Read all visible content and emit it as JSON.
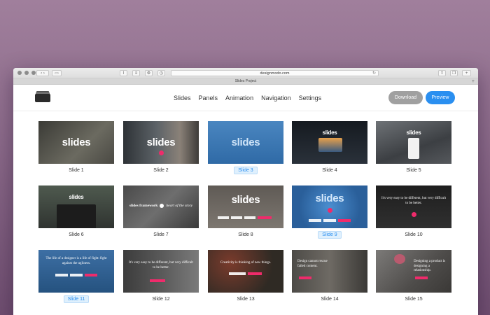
{
  "browser": {
    "url": "designmodo.com",
    "tab_title": "Slides Project",
    "tab_plus": "+"
  },
  "app": {
    "menu": [
      "Slides",
      "Panels",
      "Animation",
      "Navigation",
      "Settings"
    ],
    "download_label": "Download",
    "preview_label": "Preview"
  },
  "thumb_word": "slides",
  "slides": [
    {
      "label": "Slide 1",
      "active": false
    },
    {
      "label": "Slide 2",
      "active": false
    },
    {
      "label": "Slide 3",
      "active": true
    },
    {
      "label": "Slide 4",
      "active": false
    },
    {
      "label": "Slide 5",
      "active": false
    },
    {
      "label": "Slide 6",
      "active": false
    },
    {
      "label": "Slide 7",
      "active": false
    },
    {
      "label": "Slide 8",
      "active": false
    },
    {
      "label": "Slide 9",
      "active": true
    },
    {
      "label": "Slide 10",
      "active": false
    },
    {
      "label": "Slide 11",
      "active": true
    },
    {
      "label": "Slide 12",
      "active": false
    },
    {
      "label": "Slide 13",
      "active": false
    },
    {
      "label": "Slide 14",
      "active": false
    },
    {
      "label": "Slide 15",
      "active": false
    }
  ],
  "thumb_text": {
    "slide7": "slides framework",
    "slide7_tag": "heart of the story",
    "slide10": "It's very easy to be different, but very difficult to be better.",
    "slide11": "The life of a designer is a life of fight: fight against the ugliness.",
    "slide12": "It's very easy to be different, but very difficult to be better.",
    "slide13": "Creativity is thinking of new things.",
    "slide14": "Design cannot rescue failed content.",
    "slide15": "Designing a product is designing a relationship."
  },
  "colors": {
    "accent": "#2a8ff0",
    "pink": "#ef2b6b",
    "download_bg": "#a0a0a0"
  }
}
